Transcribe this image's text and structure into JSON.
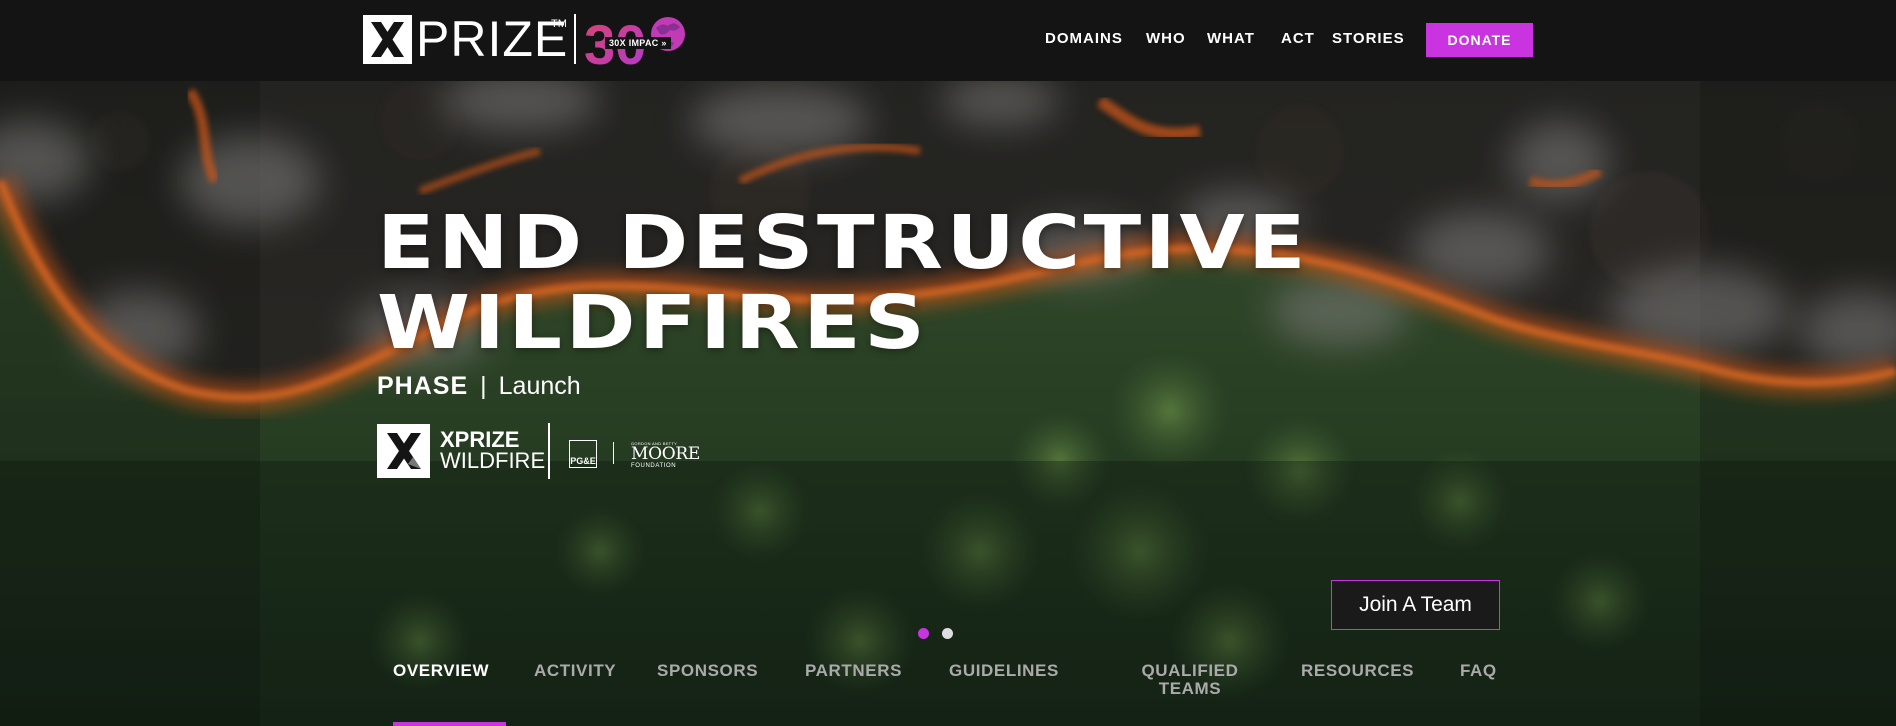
{
  "brand": {
    "logo_text": "PRIZE",
    "trademark": "TM",
    "anniversary_number": "30",
    "anniversary_tag": "30X IMPAC  »",
    "accent_color": "#c934e0"
  },
  "nav": {
    "items": [
      {
        "label": "DOMAINS"
      },
      {
        "label": "WHO"
      },
      {
        "label": "WHAT"
      },
      {
        "label": "ACT"
      },
      {
        "label": "STORIES"
      }
    ],
    "donate_label": "DONATE"
  },
  "hero": {
    "title_line1": "END DESTRUCTIVE",
    "title_line2": "WILDFIRES",
    "phase_label": "PHASE",
    "phase_separator": "|",
    "phase_value": "Launch",
    "wildfire_logo_line1": "XPRIZE",
    "wildfire_logo_line2": "WILDFIRE",
    "pgc_mark": "PG&E",
    "moore_top": "GORDON AND BETTY",
    "moore_mid": "MOORE",
    "moore_bottom": "FOUNDATION",
    "join_label": "Join A Team",
    "carousel": {
      "slides": 2,
      "active_index": 0
    }
  },
  "tabs": [
    {
      "label": "OVERVIEW",
      "active": true
    },
    {
      "label": "ACTIVITY",
      "active": false
    },
    {
      "label": "SPONSORS",
      "active": false
    },
    {
      "label": "PARTNERS",
      "active": false
    },
    {
      "label": "GUIDELINES",
      "active": false
    },
    {
      "label": "QUALIFIED TEAMS",
      "active": false
    },
    {
      "label": "RESOURCES",
      "active": false
    },
    {
      "label": "FAQ",
      "active": false
    }
  ],
  "icons": [
    "x-logo-icon",
    "globe-icon",
    "chevron-double-right-icon",
    "xprize-wildfire-x-icon"
  ]
}
